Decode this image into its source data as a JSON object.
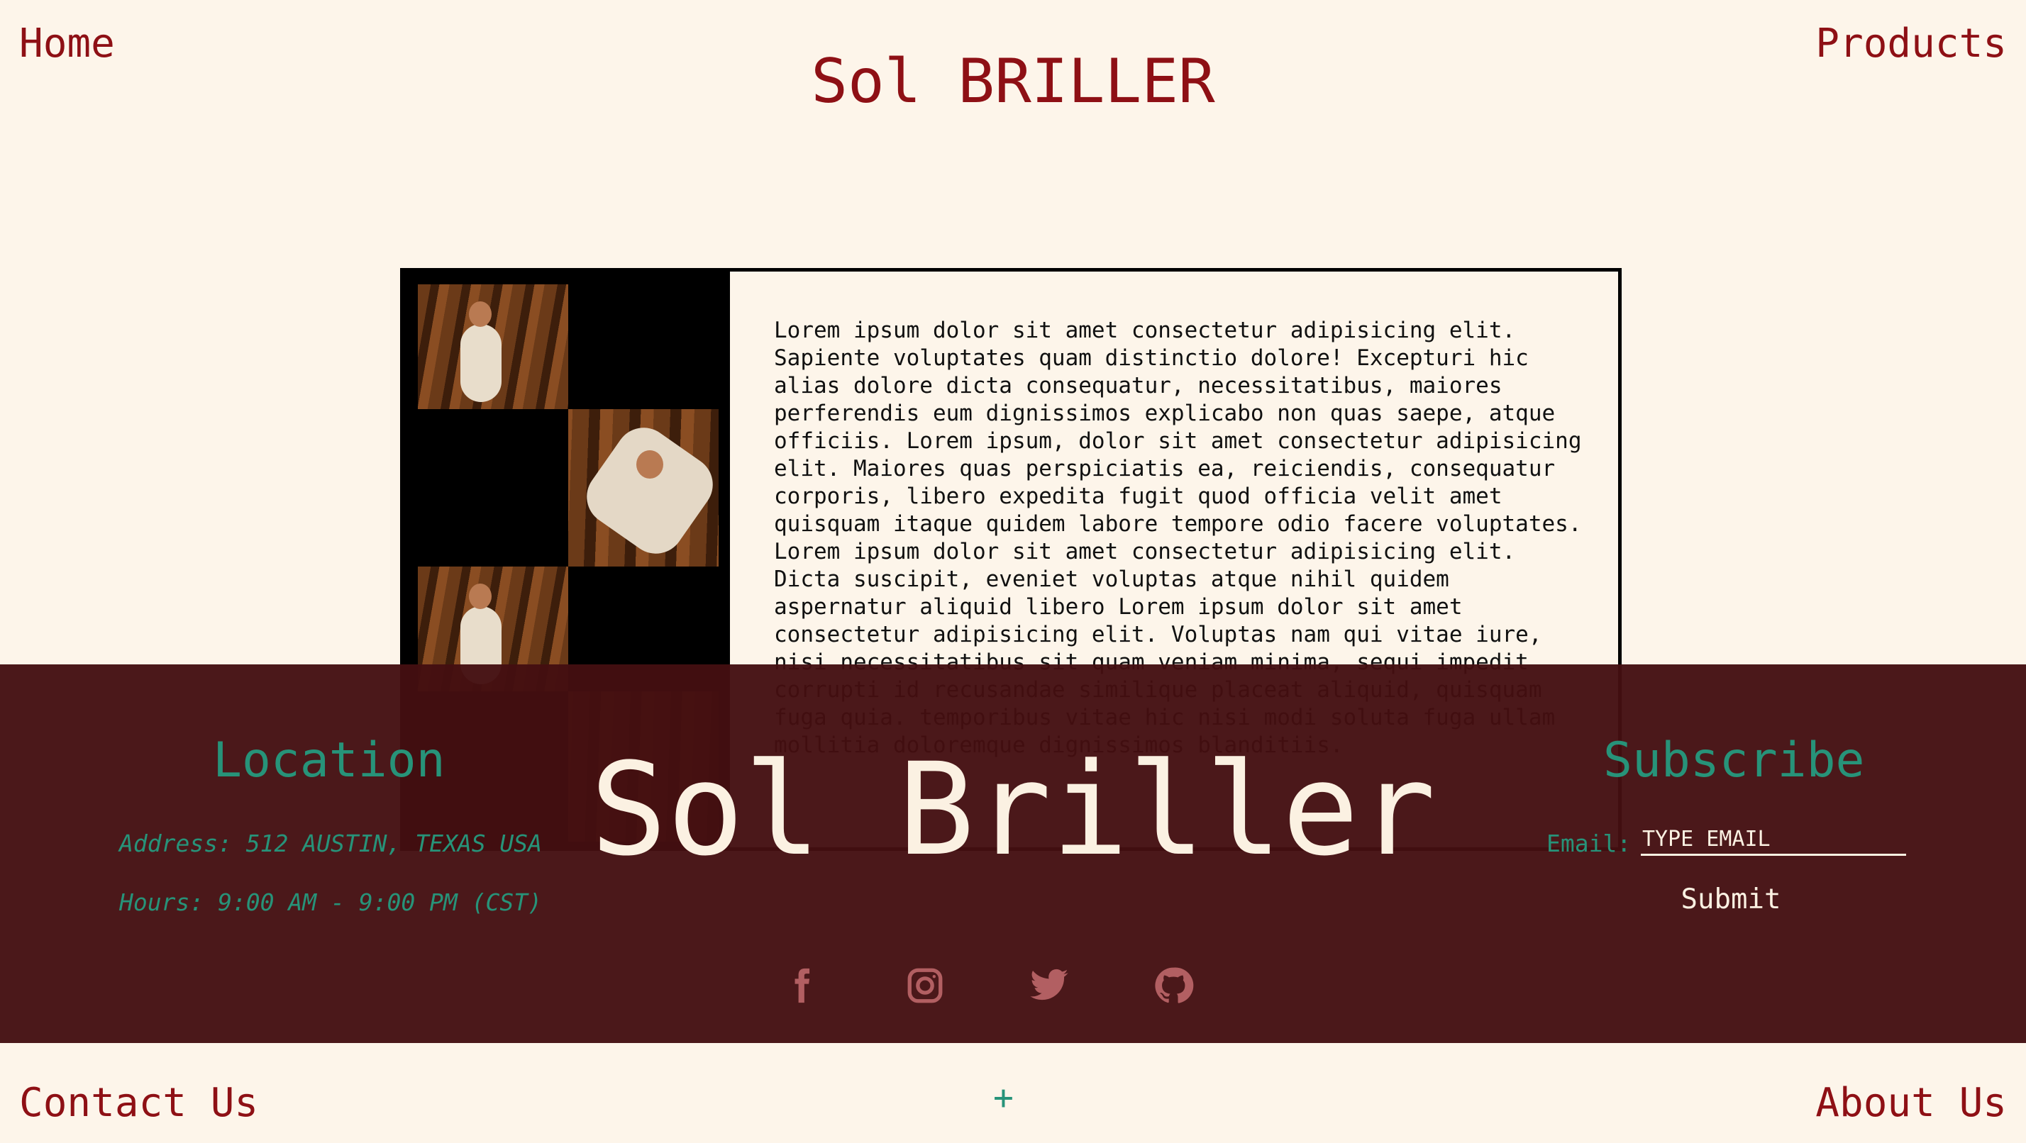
{
  "nav": {
    "home": "Home",
    "products": "Products",
    "contact": "Contact Us",
    "about": "About Us"
  },
  "brand": {
    "title": "Sol BRILLER"
  },
  "article": {
    "body": "Lorem ipsum dolor sit amet consectetur adipisicing elit. Sapiente voluptates quam distinctio dolore! Excepturi hic alias dolore dicta consequatur, necessitatibus, maiores perferendis eum dignissimos explicabo non quas saepe, atque officiis. Lorem ipsum, dolor sit amet consectetur adipisicing elit. Maiores quas perspiciatis ea, reiciendis, consequatur corporis, libero expedita fugit quod officia velit amet quisquam itaque quidem labore tempore odio facere voluptates. Lorem ipsum dolor sit amet consectetur adipisicing elit. Dicta suscipit, eveniet voluptas atque nihil quidem aspernatur aliquid libero Lorem ipsum dolor sit amet consectetur adipisicing elit. Voluptas nam qui vitae iure, nisi necessitatibus sit quam veniam minima, sequi impedit corrupti id recusandae similique placeat aliquid, quisquam fuga quia. temporibus vitae hic nisi modi soluta fuga ullam mollitia doloremque dignissimos blanditiis."
  },
  "footer": {
    "location_heading": "Location",
    "big_title": "Sol Briller",
    "subscribe_heading": "Subscribe",
    "address": "Address: 512 AUSTIN, TEXAS USA",
    "hours": "Hours: 9:00 AM - 9:00 PM (CST)",
    "email_label": "Email:",
    "email_placeholder": "TYPE EMAIL",
    "submit_label": "Submit",
    "social_icons": [
      "facebook-icon",
      "instagram-icon",
      "twitter-icon",
      "github-icon"
    ]
  },
  "plus_label": "+",
  "colors": {
    "background": "#fdf5ea",
    "brand_red": "#8e1015",
    "footer_bg": "#440f11",
    "accent_green": "#279379",
    "icon_pink": "#b25f62"
  }
}
